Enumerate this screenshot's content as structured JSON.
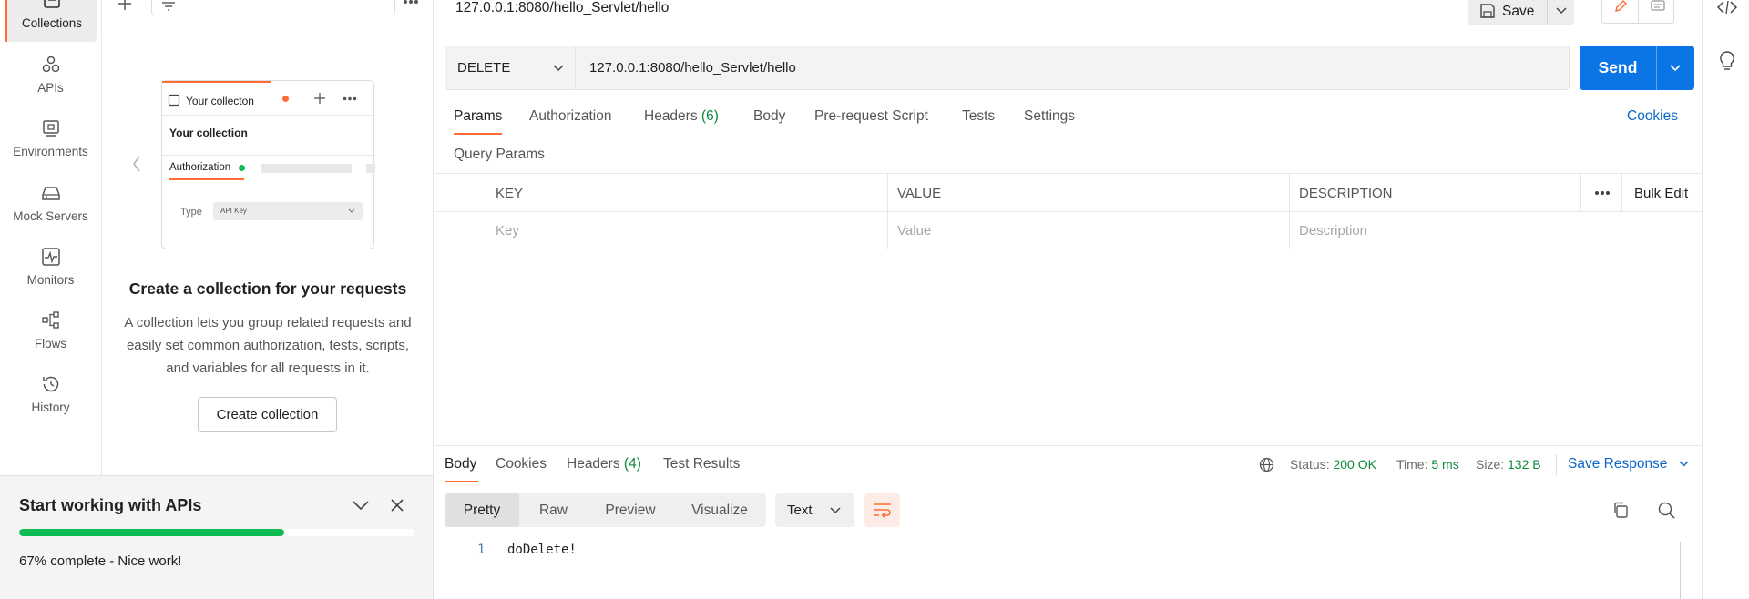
{
  "sidebar": {
    "items": [
      {
        "label": "Collections",
        "icon": "collections-icon"
      },
      {
        "label": "APIs",
        "icon": "apis-icon"
      },
      {
        "label": "Environments",
        "icon": "environments-icon"
      },
      {
        "label": "Mock Servers",
        "icon": "mock-servers-icon"
      },
      {
        "label": "Monitors",
        "icon": "monitors-icon"
      },
      {
        "label": "Flows",
        "icon": "flows-icon"
      },
      {
        "label": "History",
        "icon": "history-icon"
      }
    ]
  },
  "collections_panel": {
    "illustration": {
      "tab_title": "Your collecton",
      "heading": "Your collection",
      "auth_tab": "Authorization",
      "type_label": "Type",
      "type_value": "API Key"
    },
    "empty_title": "Create a collection for your requests",
    "empty_desc": "A collection lets you group related requests and easily set common authorization, tests, scripts, and variables for all requests in it.",
    "create_button": "Create collection"
  },
  "onboarding": {
    "title": "Start working with APIs",
    "progress": 0.67,
    "status": "67% complete - Nice work!",
    "progress_color": "#0cbb52"
  },
  "request": {
    "title": "127.0.0.1:8080/hello_Servlet/hello",
    "save_label": "Save",
    "method": "DELETE",
    "url": "127.0.0.1:8080/hello_Servlet/hello",
    "send_label": "Send",
    "tabs": {
      "params": "Params",
      "authorization": "Authorization",
      "headers": "Headers",
      "headers_count": "(6)",
      "body": "Body",
      "prerequest": "Pre-request Script",
      "tests": "Tests",
      "settings": "Settings"
    },
    "cookies_link": "Cookies",
    "query_params_label": "Query Params",
    "table": {
      "headers": {
        "key": "KEY",
        "value": "VALUE",
        "description": "DESCRIPTION",
        "bulk_edit": "Bulk Edit"
      },
      "placeholders": {
        "key": "Key",
        "value": "Value",
        "description": "Description"
      }
    }
  },
  "response": {
    "tabs": {
      "body": "Body",
      "cookies": "Cookies",
      "headers": "Headers",
      "headers_count": "(4)",
      "test_results": "Test Results"
    },
    "status_label": "Status:",
    "status_value": "200 OK",
    "time_label": "Time:",
    "time_value": "5 ms",
    "size_label": "Size:",
    "size_value": "132 B",
    "save_response": "Save Response",
    "formats": [
      "Pretty",
      "Raw",
      "Preview",
      "Visualize"
    ],
    "text_select": "Text",
    "code": [
      {
        "line": "1",
        "text": "doDelete!"
      }
    ]
  },
  "colors": {
    "accent": "#ff6c37",
    "primary": "#0b75e6",
    "success": "#0a8a3a",
    "link": "#0b66c8"
  }
}
